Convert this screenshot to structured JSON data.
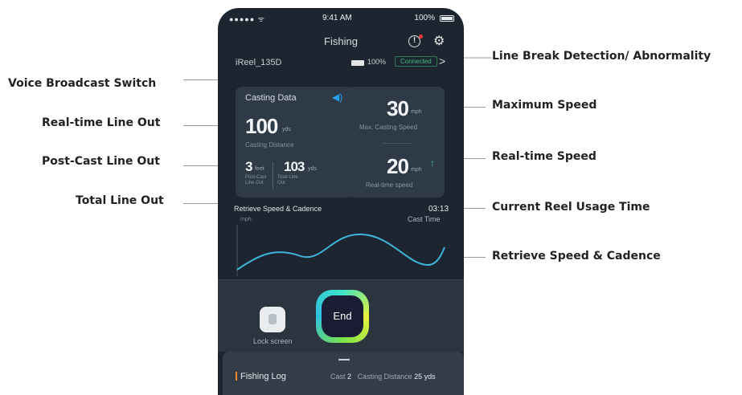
{
  "callouts": {
    "voice": "Voice Broadcast Switch",
    "realtime_line_out": "Real-time Line Out",
    "post_cast_line_out": "Post-Cast Line Out",
    "total_line_out": "Total Line Out",
    "line_break": "Line Break Detection/ Abnormality",
    "max_speed": "Maximum Speed",
    "realtime_speed": "Real-time Speed",
    "usage_time": "Current Reel Usage Time",
    "retrieve": "Retrieve Speed & Cadence"
  },
  "status_bar": {
    "signal": "●●●●● ᯤ",
    "time": "9:41 AM",
    "battery": "100%"
  },
  "header": {
    "title": "Fishing"
  },
  "device": {
    "name": "iReel_135D",
    "battery": "100%",
    "status": "Connected"
  },
  "casting_card": {
    "title": "Casting Data",
    "distance_value": "100",
    "distance_unit": "yds",
    "distance_label": "Casting Distance",
    "post_cast_value": "3",
    "post_cast_unit": "feet",
    "post_cast_label": "Post-Cast Line Out",
    "total_value": "103",
    "total_unit": "yds",
    "total_label": "Total Line Out"
  },
  "speed_card": {
    "max_value": "30",
    "max_unit": "mph",
    "max_label": "Max. Casting Speed",
    "rt_value": "20",
    "rt_unit": "mph",
    "rt_label": "Real-time speed"
  },
  "chart": {
    "title": "Retrieve Speed & Cadence",
    "unit": "mph",
    "time": "03:13",
    "time_label": "Cast Time"
  },
  "controls": {
    "lock_label": "Lock screen",
    "end_label": "End"
  },
  "log": {
    "title": "Fishing Log",
    "cast_label": "Cast",
    "cast_value": "2",
    "distance_label": "Casting Distance",
    "distance_value": "25 yds"
  },
  "colors": {
    "background": "#1d2630",
    "card": "#2e3a46",
    "accent_blue": "#2a9ff0",
    "accent_green": "#3fbf86",
    "alert_red": "#e53a3a",
    "log_orange": "#f2852e"
  }
}
